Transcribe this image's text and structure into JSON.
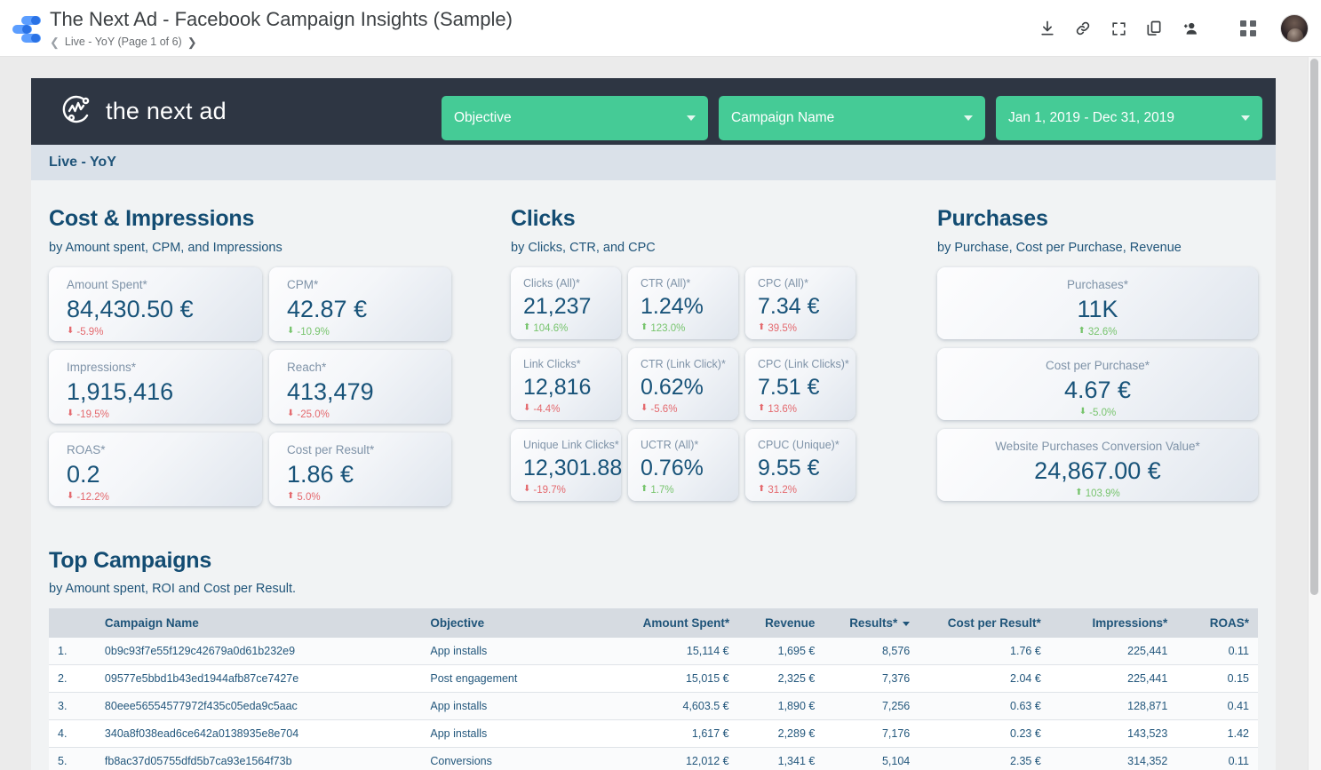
{
  "app": {
    "logo_icon": "google-data-studio-logo",
    "doc_title": "The Next Ad - Facebook Campaign Insights (Sample)",
    "breadcrumb": "Live - YoY (Page 1 of 6)",
    "prev_page_icon": "chevron-left-icon",
    "next_page_icon": "chevron-right-icon",
    "toolbar": [
      {
        "name": "download-icon",
        "glyph": "download"
      },
      {
        "name": "link-icon",
        "glyph": "link"
      },
      {
        "name": "fullscreen-icon",
        "glyph": "fullscreen"
      },
      {
        "name": "copy-icon",
        "glyph": "copy"
      },
      {
        "name": "add-person-icon",
        "glyph": "person-add"
      },
      {
        "name": "apps-grid-icon",
        "glyph": "grid"
      }
    ],
    "avatar_alt": "user-avatar"
  },
  "report": {
    "brand_name": "the next ad",
    "brand_icon": "circular-chart-logo",
    "accent_green": "#45cb96",
    "header_bg": "#2e3643",
    "filters": [
      {
        "name": "objective-filter",
        "label": "Objective"
      },
      {
        "name": "campaign-name-filter",
        "label": "Campaign Name"
      },
      {
        "name": "date-range-filter",
        "label": "Jan 1, 2019 - Dec 31, 2019"
      }
    ],
    "page_band": "Live - YoY"
  },
  "sections": {
    "cost": {
      "title": "Cost & Impressions",
      "subtitle": "by Amount spent, CPM, and Impressions",
      "cards": [
        {
          "label": "Amount Spent*",
          "value": "84,430.50 €",
          "delta": "-5.9%",
          "dir": "down",
          "tone": "bad"
        },
        {
          "label": "CPM*",
          "value": "42.87 €",
          "delta": "-10.9%",
          "dir": "down",
          "tone": "good"
        },
        {
          "label": "Impressions*",
          "value": "1,915,416",
          "delta": "-19.5%",
          "dir": "down",
          "tone": "bad"
        },
        {
          "label": "Reach*",
          "value": "413,479",
          "delta": "-25.0%",
          "dir": "down",
          "tone": "bad"
        },
        {
          "label": "ROAS*",
          "value": "0.2",
          "delta": "-12.2%",
          "dir": "down",
          "tone": "bad"
        },
        {
          "label": "Cost per Result*",
          "value": "1.86 €",
          "delta": "5.0%",
          "dir": "up",
          "tone": "bad"
        }
      ]
    },
    "clicks": {
      "title": "Clicks",
      "subtitle": "by Clicks, CTR, and CPC",
      "cards": [
        {
          "label": "Clicks (All)*",
          "value": "21,237",
          "delta": "104.6%",
          "dir": "up",
          "tone": "good"
        },
        {
          "label": "CTR (All)*",
          "value": "1.24%",
          "delta": "123.0%",
          "dir": "up",
          "tone": "good"
        },
        {
          "label": "CPC (All)*",
          "value": "7.34 €",
          "delta": "39.5%",
          "dir": "up",
          "tone": "bad"
        },
        {
          "label": "Link Clicks*",
          "value": "12,816",
          "delta": "-4.4%",
          "dir": "down",
          "tone": "bad"
        },
        {
          "label": "CTR (Link Click)*",
          "value": "0.62%",
          "delta": "-5.6%",
          "dir": "down",
          "tone": "bad"
        },
        {
          "label": "CPC (Link Clicks)*",
          "value": "7.51 €",
          "delta": "13.6%",
          "dir": "up",
          "tone": "bad"
        },
        {
          "label": "Unique Link Clicks*",
          "value": "12,301.88",
          "delta": "-19.7%",
          "dir": "down",
          "tone": "bad"
        },
        {
          "label": "UCTR (All)*",
          "value": "0.76%",
          "delta": "1.7%",
          "dir": "up",
          "tone": "good"
        },
        {
          "label": "CPUC (Unique)*",
          "value": "9.55 €",
          "delta": "31.2%",
          "dir": "up",
          "tone": "bad"
        }
      ]
    },
    "purchases": {
      "title": "Purchases",
      "subtitle": "by Purchase, Cost per Purchase, Revenue",
      "cards": [
        {
          "label": "Purchases*",
          "value": "11K",
          "delta": "32.6%",
          "dir": "up",
          "tone": "good"
        },
        {
          "label": "Cost per Purchase*",
          "value": "4.67 €",
          "delta": "-5.0%",
          "dir": "down",
          "tone": "good"
        },
        {
          "label": "Website Purchases Conversion Value*",
          "value": "24,867.00 €",
          "delta": "103.9%",
          "dir": "up",
          "tone": "good"
        }
      ]
    }
  },
  "table": {
    "title": "Top Campaigns",
    "subtitle": "by Amount spent, ROI and Cost per Result.",
    "sorted_column": "Results*",
    "sort_direction": "desc",
    "columns": [
      "",
      "Campaign Name",
      "Objective",
      "Amount Spent*",
      "Revenue",
      "Results*",
      "Cost per Result*",
      "Impressions*",
      "ROAS*"
    ],
    "rows": [
      {
        "idx": "1.",
        "name": "0b9c93f7e55f129c42679a0d61b232e9",
        "objective": "App installs",
        "spent": "15,114 €",
        "revenue": "1,695 €",
        "results": "8,576",
        "cpr": "1.76 €",
        "impressions": "225,441",
        "roas": "0.11"
      },
      {
        "idx": "2.",
        "name": "09577e5bbd1b43ed1944afb87ce7427e",
        "objective": "Post engagement",
        "spent": "15,015 €",
        "revenue": "2,325 €",
        "results": "7,376",
        "cpr": "2.04 €",
        "impressions": "225,441",
        "roas": "0.15"
      },
      {
        "idx": "3.",
        "name": "80eee56554577972f435c05eda9c5aac",
        "objective": "App installs",
        "spent": "4,603.5 €",
        "revenue": "1,890 €",
        "results": "7,256",
        "cpr": "0.63 €",
        "impressions": "128,871",
        "roas": "0.41"
      },
      {
        "idx": "4.",
        "name": "340a8f038ead6ce642a0138935e8e704",
        "objective": "App installs",
        "spent": "1,617 €",
        "revenue": "2,289 €",
        "results": "7,176",
        "cpr": "0.23 €",
        "impressions": "143,523",
        "roas": "1.42"
      },
      {
        "idx": "5.",
        "name": "fb8ac37d05755dfd5b7ca93e1564f73b",
        "objective": "Conversions",
        "spent": "12,012 €",
        "revenue": "1,341 €",
        "results": "5,104",
        "cpr": "2.35 €",
        "impressions": "314,352",
        "roas": "0.11"
      }
    ]
  }
}
